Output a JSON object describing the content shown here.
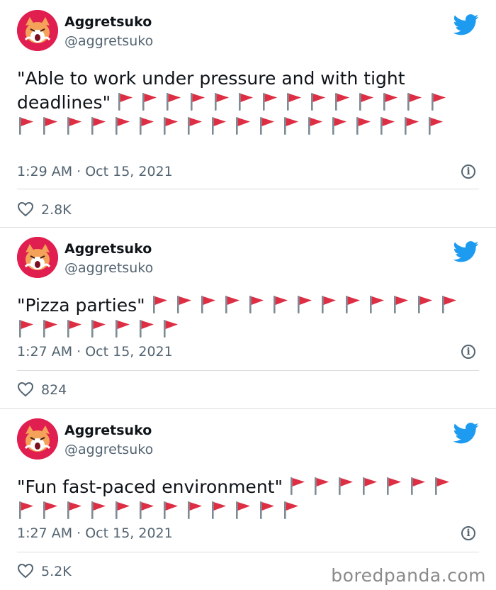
{
  "tweets": [
    {
      "name": "Aggretsuko",
      "handle": "@aggretsuko",
      "text": "\"Able to work under pressure and with tight deadlines\"",
      "flag_count": 32,
      "meta": "1:29 AM · Oct 15, 2021",
      "likes": "2.8K"
    },
    {
      "name": "Aggretsuko",
      "handle": "@aggretsuko",
      "text": "\"Pizza parties\"",
      "flag_count": 20,
      "meta": "1:27 AM · Oct 15, 2021",
      "likes": "824"
    },
    {
      "name": "Aggretsuko",
      "handle": "@aggretsuko",
      "text": "\"Fun fast-paced environment\"",
      "flag_count": 19,
      "meta": "1:27 AM · Oct 15, 2021",
      "likes": "5.2K"
    }
  ],
  "watermark": "boredpanda.com",
  "icons": {
    "bird": "twitter-bird-icon",
    "info": "info-icon",
    "heart": "heart-icon",
    "flag": "red-flag-emoji"
  },
  "colors": {
    "twitter_blue": "#1d9bf0",
    "flag_red": "#dd2e44",
    "avatar_bg": "#e01e4f",
    "muted": "#536471"
  }
}
